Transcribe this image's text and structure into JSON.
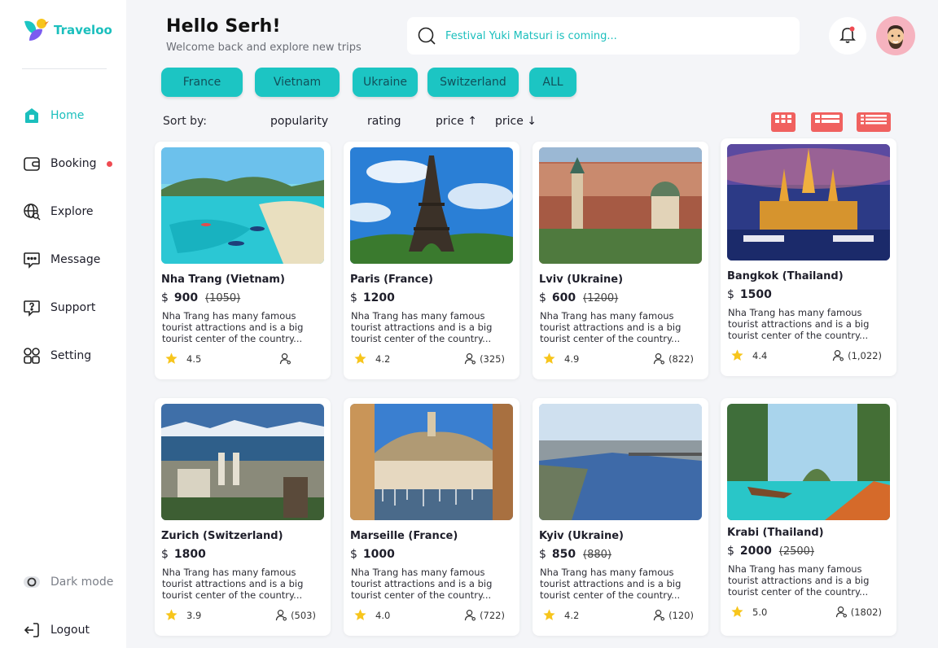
{
  "app": {
    "name": "Traveloo"
  },
  "nav": [
    {
      "label": "Home",
      "icon": "home-icon",
      "active": true,
      "dot": false
    },
    {
      "label": "Booking",
      "icon": "wallet-icon",
      "active": false,
      "dot": true
    },
    {
      "label": "Explore",
      "icon": "globe-search-icon",
      "active": false,
      "dot": false
    },
    {
      "label": "Message",
      "icon": "message-icon",
      "active": false,
      "dot": false
    },
    {
      "label": "Support",
      "icon": "help-icon",
      "active": false,
      "dot": false
    },
    {
      "label": "Setting",
      "icon": "grid-settings-icon",
      "active": false,
      "dot": false
    }
  ],
  "dark_mode": {
    "label": "Dark mode"
  },
  "logout": {
    "label": "Logout"
  },
  "header": {
    "title": "Hello Serh!",
    "subtitle": "Welcome back and explore new trips"
  },
  "search": {
    "placeholder": "Festival Yuki Matsuri is coming..."
  },
  "filters": [
    "France",
    "Vietnam",
    "Ukraine",
    "Switzerland",
    "ALL"
  ],
  "sort": {
    "label": "Sort by:",
    "options": [
      "popularity",
      "rating",
      "price ↑",
      "price ↓"
    ]
  },
  "colors": {
    "accent": "#1bbfbd",
    "chip": "#1cc5c3",
    "view_buttons": "#f0615f",
    "star": "#f7c51c",
    "notification": "#ef4b52"
  },
  "cards": [
    {
      "name": "Nha Trang (Vietnam)",
      "currency": "$",
      "price": "900",
      "old_price": "(1050)",
      "desc": "Nha Trang has many famous tourist attractions and is a big tourist center of the country...",
      "rating": "4.5",
      "reviews": ""
    },
    {
      "name": "Paris (France)",
      "currency": "$",
      "price": "1200",
      "old_price": "",
      "desc": "Nha Trang has many famous tourist attractions and is a big tourist center of the country...",
      "rating": "4.2",
      "reviews": "(325)"
    },
    {
      "name": "Lviv (Ukraine)",
      "currency": "$",
      "price": "600",
      "old_price": "(1200)",
      "desc": "Nha Trang has many famous tourist attractions and is a big tourist center of the country...",
      "rating": "4.9",
      "reviews": "(822)"
    },
    {
      "name": "Bangkok (Thailand)",
      "currency": "$",
      "price": "1500",
      "old_price": "",
      "desc": "Nha Trang has many famous tourist attractions and is a big tourist center of the country...",
      "rating": "4.4",
      "reviews": "(1,022)"
    },
    {
      "name": "Zurich (Switzerland)",
      "currency": "$",
      "price": "1800",
      "old_price": "",
      "desc": "Nha Trang has many famous tourist attractions and is a big tourist center of the country...",
      "rating": "3.9",
      "reviews": "(503)"
    },
    {
      "name": "Marseille (France)",
      "currency": "$",
      "price": "1000",
      "old_price": "",
      "desc": "Nha Trang has many famous tourist attractions and is a big tourist center of the country...",
      "rating": "4.0",
      "reviews": "(722)"
    },
    {
      "name": "Kyiv (Ukraine)",
      "currency": "$",
      "price": "850",
      "old_price": "(880)",
      "desc": "Nha Trang has many famous tourist attractions and is a big tourist center of the country...",
      "rating": "4.2",
      "reviews": "(120)"
    },
    {
      "name": "Krabi (Thailand)",
      "currency": "$",
      "price": "2000",
      "old_price": "(2500)",
      "desc": "Nha Trang has many famous tourist attractions and is a big tourist center of the country...",
      "rating": "5.0",
      "reviews": "(1802)"
    }
  ]
}
